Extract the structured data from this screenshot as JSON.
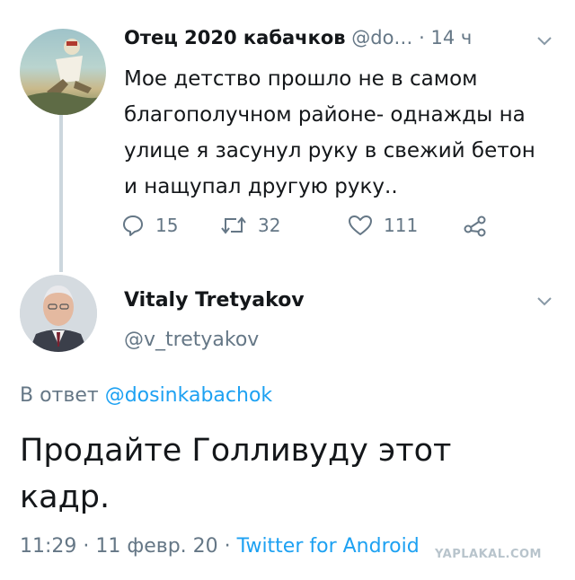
{
  "tweet1": {
    "name": "Отец 2020 кабачков",
    "handle": "@do…",
    "separator": "·",
    "time": "14 ч",
    "text": "Мое детство прошло не в самом благополучном районе- однажды на улице я засунул руку в свежий бетон и нащупал другую руку..",
    "replies": "15",
    "retweets": "32",
    "likes": "111",
    "icons": {
      "reply": "reply-icon",
      "retweet": "retweet-icon",
      "like": "heart-icon",
      "share": "share-icon",
      "menu": "chevron-down-icon"
    }
  },
  "tweet2": {
    "name": "Vitaly Tretyakov",
    "handle": "@v_tretyakov",
    "reply_prefix": "В ответ",
    "reply_mention": "@dosinkabachok",
    "text": "Продайте Голливуду этот кадр.",
    "time": "11:29",
    "separator1": "·",
    "date": "11 февр. 20",
    "separator2": "·",
    "client": "Twitter for Android"
  },
  "watermark": "YAPLAKAL.COM",
  "colors": {
    "accent": "#1da1f2",
    "secondary_text": "#657786",
    "primary_text": "#14171a",
    "thread_line": "#ccd6dd"
  }
}
